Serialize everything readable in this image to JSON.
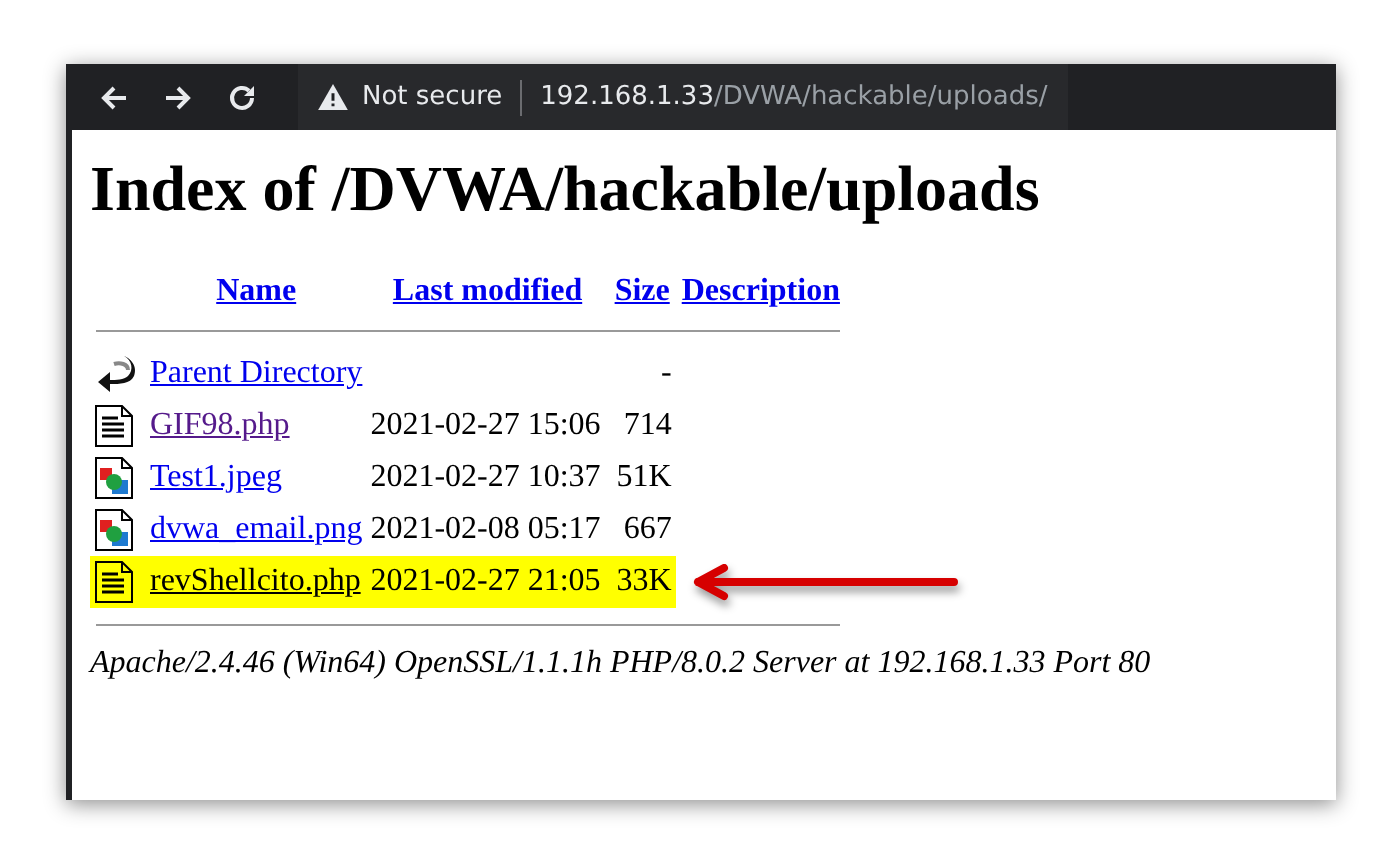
{
  "browser": {
    "security_label": "Not secure",
    "url_host": "192.168.1.33",
    "url_path": "/DVWA/hackable/uploads/"
  },
  "heading": "Index of /DVWA/hackable/uploads",
  "columns": [
    {
      "label": "Name"
    },
    {
      "label": "Last modified"
    },
    {
      "label": "Size"
    },
    {
      "label": "Description"
    }
  ],
  "rows": [
    {
      "kind": "back",
      "name": "Parent Directory",
      "size": "-",
      "visited": false,
      "highlighted": false
    },
    {
      "kind": "text",
      "name": "GIF98.php",
      "modified": "2021-02-27 15:06",
      "size": "714",
      "visited": true,
      "highlighted": false
    },
    {
      "kind": "image",
      "name": "Test1.jpeg",
      "modified": "2021-02-27 10:37",
      "size": "51K",
      "visited": false,
      "highlighted": false
    },
    {
      "kind": "image",
      "name": "dvwa_email.png",
      "modified": "2021-02-08 05:17",
      "size": "667",
      "visited": false,
      "highlighted": false
    },
    {
      "kind": "text",
      "name": "revShellcito.php",
      "modified": "2021-02-27 21:05",
      "size": "33K",
      "visited": false,
      "highlighted": true
    }
  ],
  "footer": "Apache/2.4.46 (Win64) OpenSSL/1.1.1h PHP/8.0.2 Server at 192.168.1.33 Port 80"
}
